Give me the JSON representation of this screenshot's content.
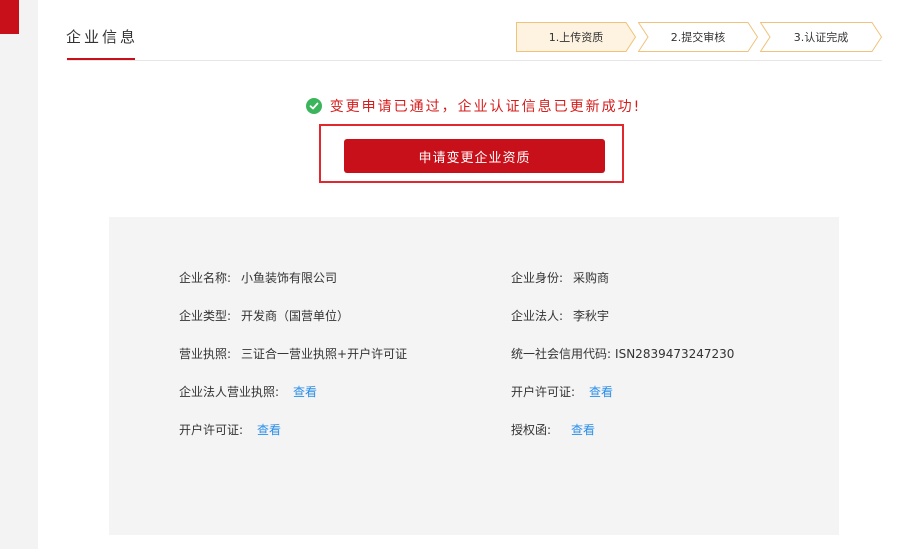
{
  "header": {
    "title": "企业信息"
  },
  "steps": [
    {
      "label": "1.上传资质"
    },
    {
      "label": "2.提交审核"
    },
    {
      "label": "3.认证完成"
    }
  ],
  "status": {
    "message": "变更申请已通过，企业认证信息已更新成功!"
  },
  "actions": {
    "apply_change_label": "申请变更企业资质"
  },
  "info": {
    "company_name": {
      "label": "企业名称:",
      "value": "小鱼装饰有限公司"
    },
    "company_role": {
      "label": "企业身份:",
      "value": "采购商"
    },
    "company_type": {
      "label": "企业类型:",
      "value": "开发商（国营单位）"
    },
    "legal_person": {
      "label": "企业法人:",
      "value": "李秋宇"
    },
    "business_license": {
      "label": "营业执照:",
      "value": "三证合一营业执照+开户许可证"
    },
    "credit_code": {
      "label": "统一社会信用代码:",
      "value": "ISN2839473247230"
    },
    "legal_license": {
      "label": "企业法人营业执照:",
      "link": "查看"
    },
    "account_permit_right": {
      "label": "开户许可证:",
      "link": "查看"
    },
    "account_permit_left": {
      "label": "开户许可证:",
      "link": "查看"
    },
    "authorization": {
      "label": "授权函:",
      "link": "查看"
    }
  },
  "colors": {
    "brand_red": "#c8101a",
    "success_green": "#3bb55b",
    "link_blue": "#2a8ee8",
    "step_fill": "#fdf3e0",
    "step_border": "#f0c27a"
  }
}
